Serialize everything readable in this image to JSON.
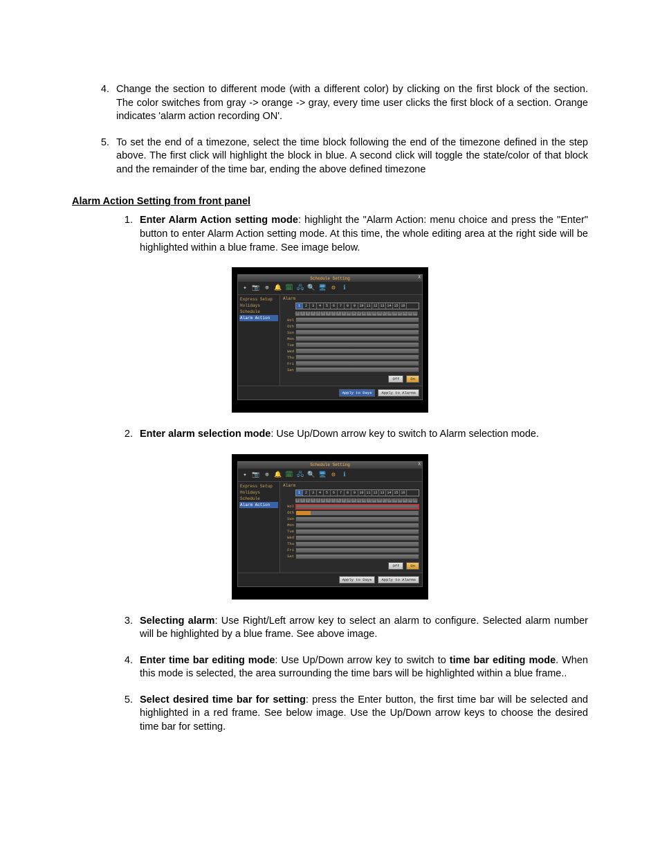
{
  "list_top": {
    "item4": "Change the section to different mode (with a different color) by clicking on the first block of the section. The color switches from gray -> orange -> gray, every time user clicks the first block of a section. Orange indicates 'alarm action recording ON'.",
    "item5": "To set the end of a timezone, select the time block following the end of the timezone defined in the step above. The first click will highlight the block in blue. A second click will toggle the state/color of that block and the remainder of the time bar, ending the above defined timezone"
  },
  "section_title": "Alarm Action Setting from front panel",
  "list_sub": {
    "item1_bold": "Enter Alarm Action setting mode",
    "item1_rest": ": highlight the \"Alarm Action: menu choice and press the \"Enter\" button to enter Alarm Action setting mode. At this time, the whole editing area at the right side will be highlighted within a blue frame. See image below.",
    "item2_bold": "Enter alarm selection mode",
    "item2_rest": ": Use Up/Down arrow key to switch to Alarm selection mode.",
    "item3_bold": "Selecting alarm",
    "item3_rest": ": Use Right/Left arrow key to select an alarm to configure. Selected alarm number will be highlighted by a blue frame. See above image.",
    "item4_bold": "Enter time bar editing mode",
    "item4_mid": ": Use Up/Down arrow key to switch to ",
    "item4_bold2": "time bar editing mode",
    "item4_rest": ". When this mode is selected, the area surrounding the time bars will be highlighted within a blue frame..",
    "item5_bold": "Select desired time bar for setting",
    "item5_rest": ": press the Enter button, the first time bar will be selected and highlighted in a red frame. See below image. Use the Up/Down arrow keys to choose the desired time bar for setting."
  },
  "dvr": {
    "title": "Schedule Setting",
    "close": "X",
    "side": {
      "items": [
        "Express Setup",
        "Holidays",
        "Schedule",
        "Alarm Action"
      ],
      "selected_index": 3
    },
    "alarm_label": "Alarm",
    "alarm_numbers": [
      "1",
      "2",
      "3",
      "4",
      "5",
      "6",
      "7",
      "8",
      "9",
      "10",
      "11",
      "12",
      "13",
      "14",
      "15",
      "16"
    ],
    "alarm_selected_index": 0,
    "hours": [
      "0",
      "1",
      "2",
      "3",
      "4",
      "5",
      "6",
      "7",
      "8",
      "9",
      "10",
      "11",
      "12",
      "13",
      "14",
      "15",
      "16",
      "17",
      "18",
      "19",
      "20",
      "21",
      "22",
      "23"
    ],
    "days": [
      "Hol",
      "Oth",
      "Sun",
      "Mon",
      "Tue",
      "Wed",
      "Thu",
      "Fri",
      "Sat"
    ],
    "legend_off": "Off",
    "legend_on": "On",
    "apply_days": "Apply to Days",
    "apply_alarms": "Apply to Alarms"
  },
  "fig1": {
    "selected_day_index": -1,
    "apply_days_selected": true
  },
  "fig2": {
    "selected_day_index": 0,
    "orange_start_index": 1,
    "apply_days_selected": false
  }
}
